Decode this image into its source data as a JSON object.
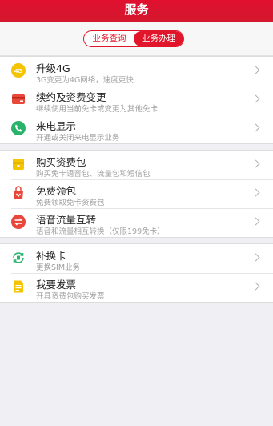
{
  "header": {
    "title": "服务"
  },
  "segment": {
    "options": [
      {
        "label": "业务查询",
        "active": false
      },
      {
        "label": "业务办理",
        "active": true
      }
    ],
    "accent_color": "#e2162b"
  },
  "groups": [
    {
      "items": [
        {
          "title": "升级4G",
          "subtitle": "3G变更为4G网络，速度更快",
          "icon": "4g-badge-icon",
          "icon_color": "#f5c400"
        },
        {
          "title": "续约及资费变更",
          "subtitle": "继续使用当前免卡或变更为其他免卡",
          "icon": "card-icon",
          "icon_color": "#e8473a"
        },
        {
          "title": "来电显示",
          "subtitle": "开通或关闭来电显示业务",
          "icon": "phone-icon",
          "icon_color": "#27b36a"
        }
      ]
    },
    {
      "items": [
        {
          "title": "购买资费包",
          "subtitle": "购买免卡语音包、流量包和短信包",
          "icon": "package-icon",
          "icon_color": "#f5c400"
        },
        {
          "title": "免费领包",
          "subtitle": "免费领取免卡资费包",
          "icon": "gift-bag-icon",
          "icon_color": "#e8473a"
        },
        {
          "title": "语音流量互转",
          "subtitle": "语音和流量相互转换（仅限199免卡）",
          "icon": "swap-icon",
          "icon_color": "#e8473a"
        }
      ]
    },
    {
      "items": [
        {
          "title": "补换卡",
          "subtitle": "更换SIM业务",
          "icon": "sim-swap-icon",
          "icon_color": "#27b36a"
        },
        {
          "title": "我要发票",
          "subtitle": "开具资费包购买发票",
          "icon": "invoice-icon",
          "icon_color": "#f5c400"
        }
      ]
    }
  ]
}
